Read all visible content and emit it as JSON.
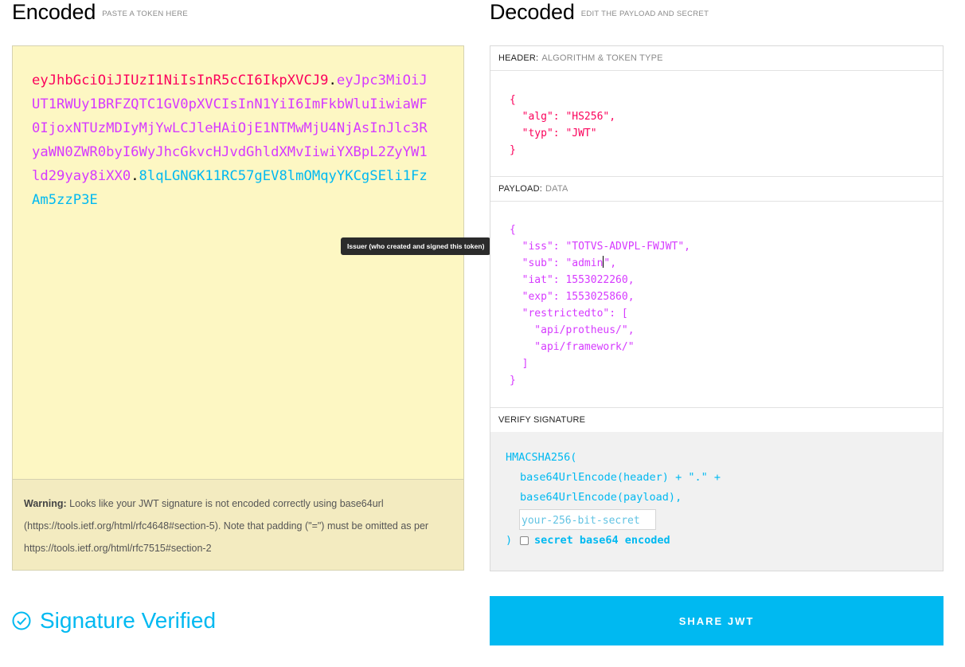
{
  "encoded": {
    "title": "Encoded",
    "subtitle": "PASTE A TOKEN HERE",
    "token_header": "eyJhbGciOiJIUzI1NiIsInR5cCI6IkpXVCJ9",
    "token_payload": "eyJpc3MiOiJUT1RWUy1BRFZQTC1GV0pXVCIsInN1YiI6ImFkbWluIiwiaWF0IjoxNTUzMDIyMjYwLCJleHAiOjE1NTMwMjU4NjAsInJlc3RyaWN0ZWR0byI6WyJhcGkvcHJvdGhldXMvIiwiYXBpL2ZyYW1ld29yay8iXX0",
    "token_signature": "8lqLGNGK11RC57gEV8lmOMqyYKCgSEli1FzAm5zzP3E",
    "dot": ".",
    "warning_bold": "Warning:",
    "warning_text": " Looks like your JWT signature is not encoded correctly using base64url (https://tools.ietf.org/html/rfc4648#section-5). Note that padding (\"=\") must be omitted as per https://tools.ietf.org/html/rfc7515#section-2"
  },
  "tooltip": "Issuer (who created and signed this token)",
  "decoded": {
    "title": "Decoded",
    "subtitle": "EDIT THE PAYLOAD AND SECRET",
    "header_label": "HEADER:",
    "header_sub": "ALGORITHM & TOKEN TYPE",
    "header_json": "{\n  \"alg\": \"HS256\",\n  \"typ\": \"JWT\"\n}",
    "payload_label": "PAYLOAD:",
    "payload_sub": "DATA",
    "payload_json_before_cursor": "{\n  \"iss\": \"TOTVS-ADVPL-FWJWT\",\n  \"sub\": \"admin",
    "payload_json_after_cursor": "\",\n  \"iat\": 1553022260,\n  \"exp\": 1553025860,\n  \"restrictedto\": [\n    \"api/protheus/\",\n    \"api/framework/\"\n  ]\n}",
    "verify_label": "VERIFY SIGNATURE",
    "verify_line1": "HMACSHA256(",
    "verify_line2": "base64UrlEncode(header) + \".\" +",
    "verify_line3": "base64UrlEncode(payload),",
    "secret_placeholder": "your-256-bit-secret",
    "verify_close": ")",
    "base64_label": "secret base64 encoded",
    "base64_checked": false
  },
  "status": {
    "text": "Signature Verified",
    "icon": "check-circle-icon",
    "color": "#00b9f1"
  },
  "share_label": "SHARE JWT"
}
